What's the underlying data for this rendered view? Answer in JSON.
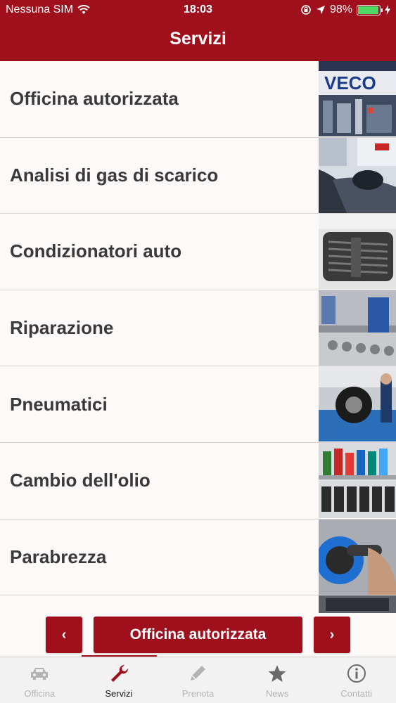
{
  "status_bar": {
    "carrier": "Nessuna SIM",
    "time": "18:03",
    "battery": "98%",
    "battery_level": 0.98
  },
  "nav": {
    "title": "Servizi"
  },
  "services": [
    {
      "label": "Officina autorizzata"
    },
    {
      "label": "Analisi di gas di scarico"
    },
    {
      "label": "Condizionatori auto"
    },
    {
      "label": "Riparazione"
    },
    {
      "label": "Pneumatici"
    },
    {
      "label": "Cambio dell'olio"
    },
    {
      "label": "Parabrezza"
    },
    {
      "label": ""
    }
  ],
  "thumb_logo_text": "VECO",
  "controls": {
    "prev": "‹",
    "current": "Officina autorizzata",
    "next": "›"
  },
  "tabs": [
    {
      "label": "Officina",
      "icon": "car-icon",
      "active": false
    },
    {
      "label": "Servizi",
      "icon": "wrench-icon",
      "active": true
    },
    {
      "label": "Prenota",
      "icon": "pencil-icon",
      "active": false
    },
    {
      "label": "News",
      "icon": "star-icon",
      "active": false
    },
    {
      "label": "Contatti",
      "icon": "info-icon",
      "active": false
    }
  ],
  "colors": {
    "brand": "#a0101c",
    "background": "#fdf9f9",
    "tab_active": "#1a1a1a",
    "tab_inactive": "#b3b3b3",
    "battery": "#4cd964"
  }
}
